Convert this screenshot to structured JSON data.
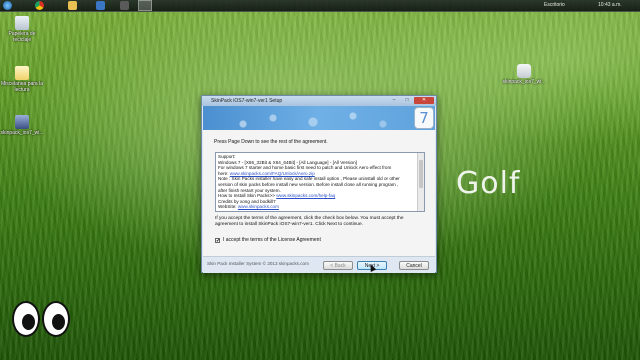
{
  "taskbar": {
    "tray_text": "Escritorio",
    "clock": "10:43 a.m."
  },
  "desktop": {
    "icons": [
      {
        "label": "Papelera de reciclaje"
      },
      {
        "label": "Miscelanea para la lectura"
      },
      {
        "label": "skinpack_ios7_wi..."
      },
      {
        "label": "skinpack_ios7_wi..."
      }
    ],
    "wallpaper_text": "Golf"
  },
  "dialog": {
    "title": "SkinPack iOS7-win7-ver1 Setup",
    "logo_text": "7",
    "minimize": "–",
    "maximize": "□",
    "close": "✕",
    "instruction": "Press Page Down to see the rest of the agreement.",
    "license_lines": [
      {
        "text": "Support:"
      },
      {
        "text": "Windows 7 - [X86_32Bit & X64_64Bit] - [All Language] - [All Version]"
      },
      {
        "text": "For windows 7 starter and home basic first need to patch and Unlock Aero effect from"
      },
      {
        "text": "here: ",
        "link": "www.skinpacks.com/FAQ/Unlock/Aero.zip"
      },
      {
        "text": "Note : Skin Packs installer have easy and safe install option , Please uninstall old or other"
      },
      {
        "text": "version of skin packs before install new version. Before install close all running program ,"
      },
      {
        "text": "after finish restart your system."
      },
      {
        "text": "How to Install Skin Packs>> ",
        "link": "www.skinpacks.com/help-faq"
      },
      {
        "text": "Credits by xong and bodkill7"
      },
      {
        "text": "WebSite: ",
        "link": "www.skinpacks.com"
      }
    ],
    "agree_text": "If you accept the terms of the agreement, click the check box below. You must accept the agreement to install SkinPack iOS7-win7-ver1. Click Next to continue.",
    "checkbox_checked": "✔",
    "checkbox_label": "I accept the terms of the License Agreement",
    "footer_text": "Skin Pack Installer System © 2013 skinpacks.com",
    "buttons": {
      "back": "< Back",
      "next": "Next >",
      "cancel": "Cancel"
    }
  }
}
